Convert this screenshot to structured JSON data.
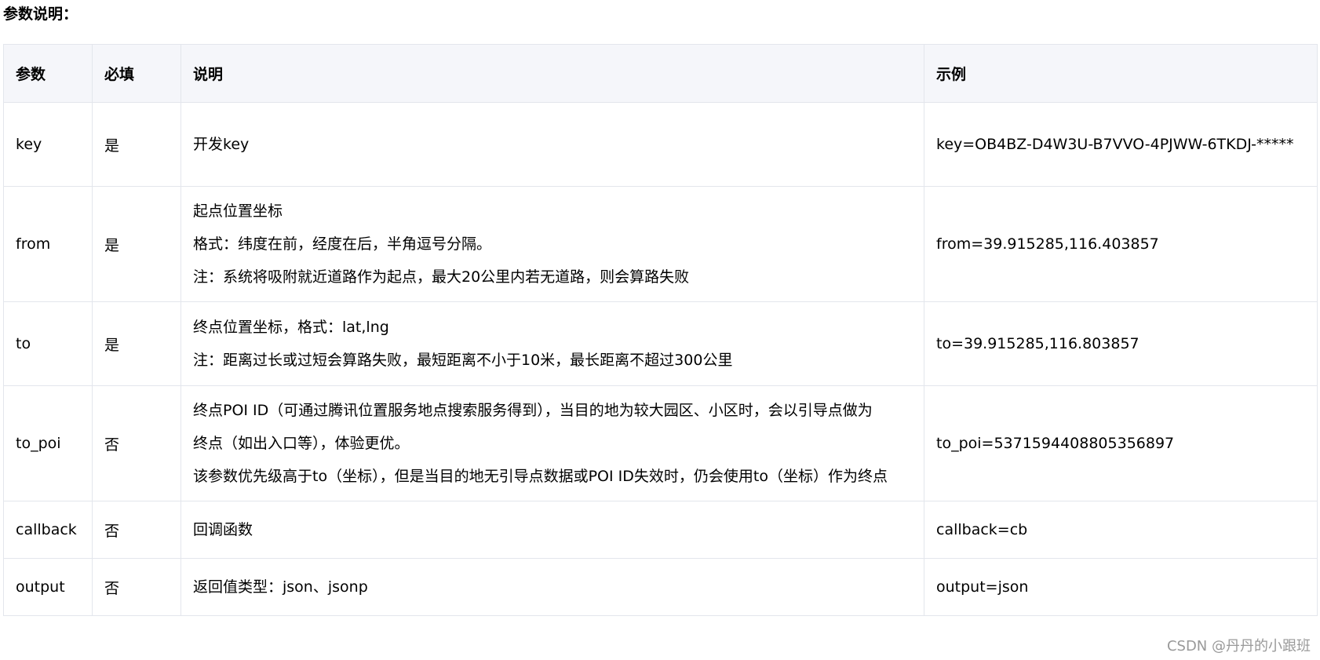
{
  "section_title": "参数说明：",
  "table": {
    "headers": {
      "param": "参数",
      "required": "必填",
      "description": "说明",
      "example": "示例"
    },
    "rows": [
      {
        "param": "key",
        "required": "是",
        "description": [
          "开发key"
        ],
        "example": "key=OB4BZ-D4W3U-B7VVO-4PJWW-6TKDJ-*****"
      },
      {
        "param": "from",
        "required": "是",
        "description": [
          "起点位置坐标",
          "格式：纬度在前，经度在后，半角逗号分隔。",
          "注：系统将吸附就近道路作为起点，最大20公里内若无道路，则会算路失败"
        ],
        "example": "from=39.915285,116.403857"
      },
      {
        "param": "to",
        "required": "是",
        "description": [
          "终点位置坐标，格式：lat,lng",
          "注：距离过长或过短会算路失败，最短距离不小于10米，最长距离不超过300公里"
        ],
        "example": "to=39.915285,116.803857"
      },
      {
        "param": "to_poi",
        "required": "否",
        "description": [
          "终点POI ID（可通过腾讯位置服务地点搜索服务得到），当目的地为较大园区、小区时，会以引导点做为",
          "终点（如出入口等），体验更优。",
          "该参数优先级高于to（坐标），但是当目的地无引导点数据或POI ID失效时，仍会使用to（坐标）作为终点"
        ],
        "example": "to_poi=5371594408805356897"
      },
      {
        "param": "callback",
        "required": "否",
        "description": [
          "回调函数"
        ],
        "example": "callback=cb"
      },
      {
        "param": "output",
        "required": "否",
        "description": [
          "返回值类型：json、jsonp"
        ],
        "example": "output=json"
      }
    ]
  },
  "watermark": "CSDN @丹丹的小跟班",
  "colors": {
    "header_bg": "#f5f6fa",
    "border": "#e3e6ec",
    "watermark": "#999999"
  }
}
